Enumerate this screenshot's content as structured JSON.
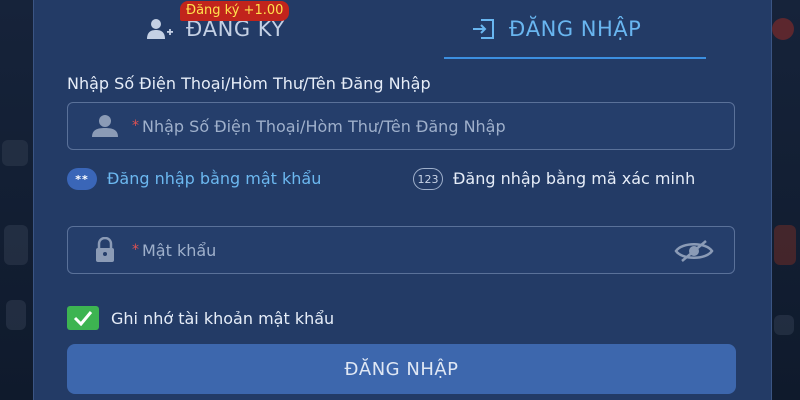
{
  "tabs": {
    "register_label": "ĐĂNG KÝ",
    "login_label": "ĐĂNG NHẬP",
    "register_badge": "Đăng ký +1.00"
  },
  "form": {
    "username_label": "Nhập Số Điện Thoại/Hòm Thư/Tên Đăng Nhập",
    "username_placeholder": "Nhập Số Điện Thoại/Hòm Thư/Tên Đăng Nhập",
    "required_mark": "*",
    "login_modes": [
      {
        "label": "Đăng nhập bằng mật khẩu",
        "icon_text": "**",
        "selected": true
      },
      {
        "label": "Đăng nhập bằng mã xác minh",
        "icon_text": "123",
        "selected": false
      }
    ],
    "password_placeholder": "Mật khẩu",
    "remember_label": "Ghi nhớ tài khoản mật khẩu",
    "remember_checked": true,
    "submit_label": "ĐĂNG NHẬP"
  },
  "icons": {
    "register_tab": "add-user-icon",
    "login_tab": "login-door-icon",
    "username_field": "user-icon",
    "password_field": "lock-icon",
    "password_toggle": "eye-off-icon",
    "checkbox": "checkmark-icon"
  },
  "colors": {
    "panel": "#233b66",
    "active_tab": "#69b6f0",
    "badge_bg": "#c1241c",
    "badge_text": "#ffe14d",
    "checkbox": "#3db451",
    "submit": "#3d67ad",
    "required": "#e05252"
  }
}
